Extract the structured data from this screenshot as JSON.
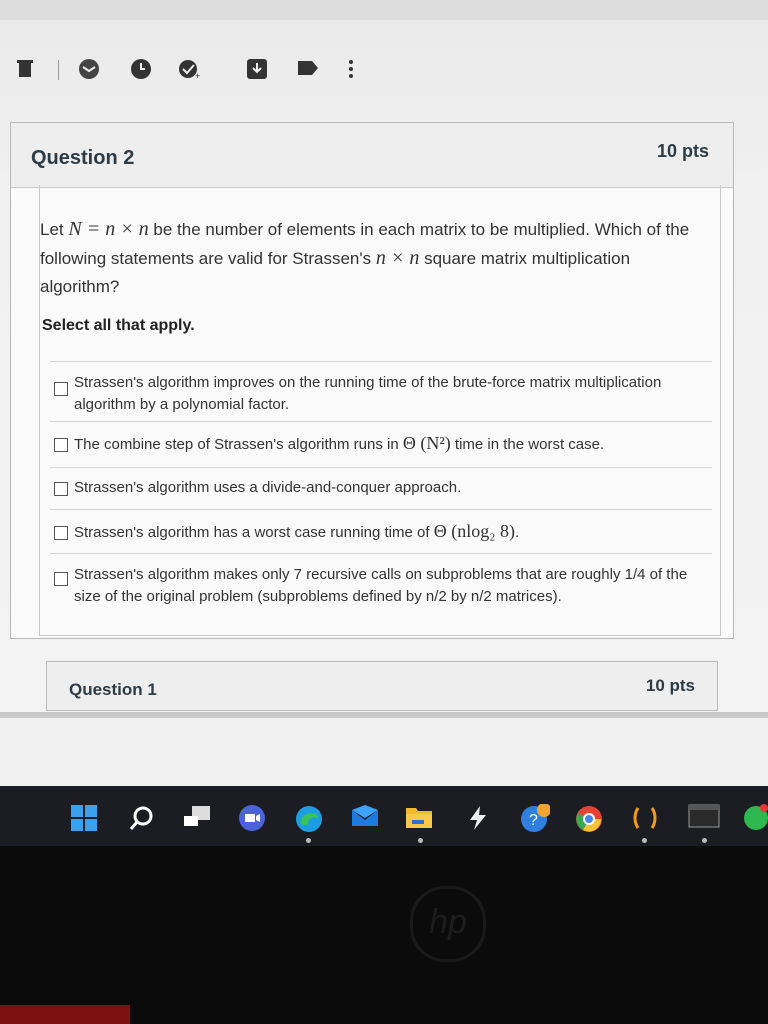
{
  "toolbar": {
    "icons": [
      "delete-icon",
      "mark-read-icon",
      "clock-icon",
      "check-badge-icon",
      "download-icon",
      "tag-icon",
      "more-vertical-icon"
    ]
  },
  "question": {
    "title": "Question 2",
    "points": "10 pts",
    "prompt_prefix": "Let ",
    "prompt_math1": "N = n × n",
    "prompt_mid": " be the number of elements in each matrix to be multiplied. Which of the following statements are valid for Strassen's ",
    "prompt_math2": "n × n",
    "prompt_suffix": " square matrix multiplication algorithm?",
    "instruction": "Select all that apply.",
    "options": [
      {
        "text": "Strassen's algorithm improves on the running time of the brute-force matrix multiplication algorithm by a polynomial factor."
      },
      {
        "prefix": "The combine step of Strassen's algorithm runs in ",
        "math": "Θ (N²)",
        "suffix": " time in the worst case."
      },
      {
        "text": "Strassen's algorithm uses a divide-and-conquer approach."
      },
      {
        "prefix": "Strassen's algorithm has a worst case running time of ",
        "math": "Θ (nlog₂ 8)",
        "suffix": "."
      },
      {
        "text": "Strassen's algorithm makes only 7 recursive calls on subproblems that are roughly 1/4 of the size of the original problem (subproblems defined by n/2 by n/2 matrices)."
      }
    ]
  },
  "next_question": {
    "title": "Question 1",
    "points": "10 pts"
  },
  "taskbar": {
    "icons": [
      "windows-start-icon",
      "search-icon",
      "task-view-icon",
      "zoom-icon",
      "edge-icon",
      "mail-icon",
      "file-explorer-icon",
      "app-icon",
      "help-icon",
      "chrome-icon",
      "app2-icon",
      "terminal-icon",
      "whatsapp-icon"
    ]
  },
  "hardware": {
    "logo": "hp"
  }
}
